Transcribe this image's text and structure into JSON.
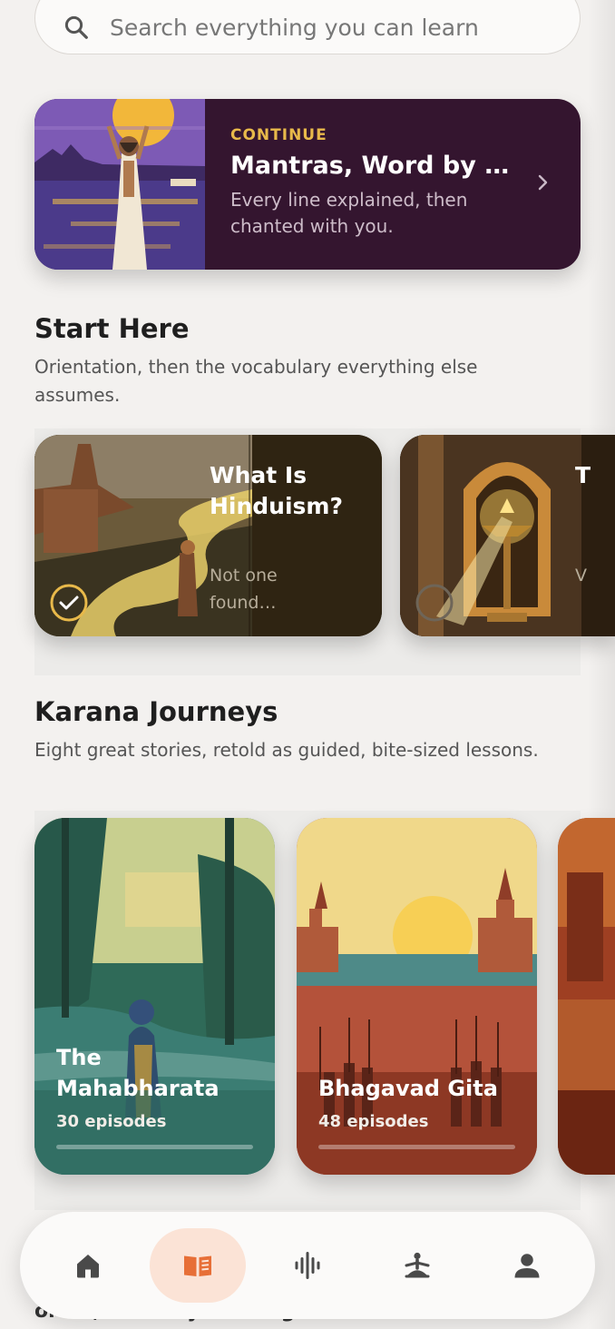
{
  "search": {
    "placeholder": "Search everything you can learn"
  },
  "continue": {
    "eyebrow": "CONTINUE",
    "title": "Mantras, Word by W…",
    "subtitle": "Every line explained, then chanted with you."
  },
  "start_here": {
    "title": "Start Here",
    "subtitle": "Orientation, then the vocabulary everything else assumes.",
    "cards": [
      {
        "title": "What Is Hinduism?",
        "subtitle": "Not one found…",
        "completed": true
      },
      {
        "title": "T",
        "subtitle": "V",
        "completed": false
      }
    ]
  },
  "journeys": {
    "title": "Karana Journeys",
    "subtitle": "Eight great stories, retold as guided, bite-sized lessons.",
    "cards": [
      {
        "title": "The Mahabharata",
        "episodes": "30 episodes",
        "progress": 0
      },
      {
        "title": "Bhagavad Gita",
        "episodes": "48 episodes",
        "progress": 0
      }
    ]
  },
  "partial_text": "order, no story framing.",
  "nav": {
    "items": [
      {
        "icon": "home-icon",
        "active": false
      },
      {
        "icon": "book-icon",
        "active": true
      },
      {
        "icon": "audio-wave-icon",
        "active": false
      },
      {
        "icon": "meditation-icon",
        "active": false
      },
      {
        "icon": "profile-icon",
        "active": false
      }
    ],
    "accent": "#e76f37"
  }
}
